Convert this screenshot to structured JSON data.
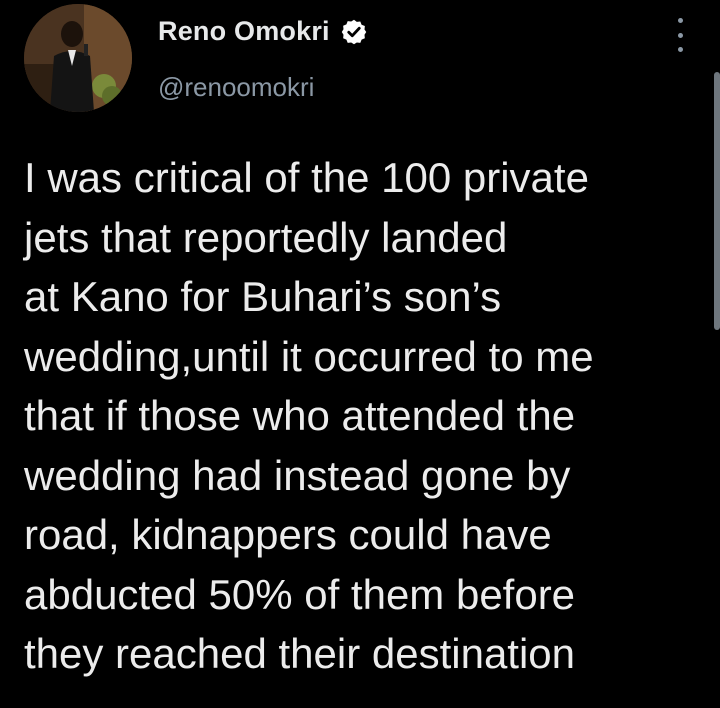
{
  "author": {
    "display_name": "Reno Omokri",
    "handle": "@renoomokri",
    "verified": true,
    "verified_icon": "verified-badge-icon",
    "avatar_icon": "profile-photo"
  },
  "menu": {
    "icon": "more-options-icon"
  },
  "tweet": {
    "lines": [
      "I was critical of the 100 private",
      "jets that reportedly landed",
      "at Kano for Buhari’s son’s",
      "wedding,until it occurred to me",
      "that if those who attended the",
      "wedding had instead gone by",
      "road, kidnappers could have",
      "abducted 50% of them before",
      "they reached their destination"
    ]
  },
  "colors": {
    "background": "#000000",
    "text": "#e7e9ea",
    "secondary_text": "#8b98a5",
    "verified_badge": "#ffffff"
  }
}
